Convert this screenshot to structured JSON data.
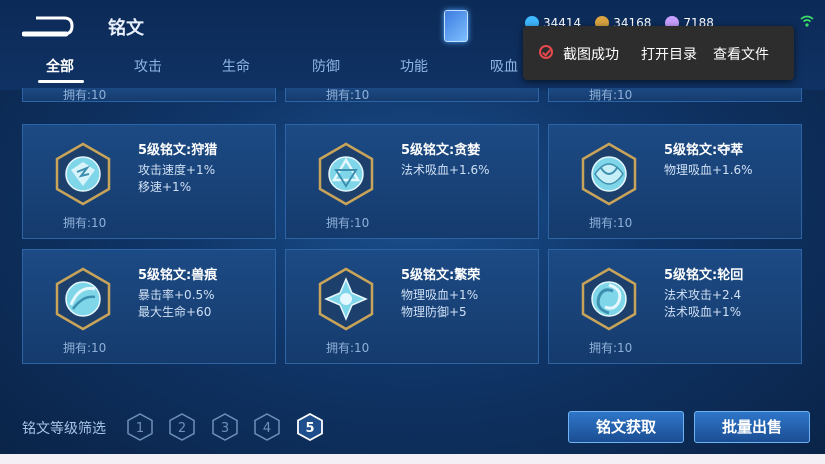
{
  "header": {
    "title": "铭文",
    "currencies": [
      {
        "icon": "diamond-icon",
        "value": "34414",
        "color": "#3fb8ff"
      },
      {
        "icon": "gold-coin-icon",
        "value": "34168",
        "color": "#d9a441"
      },
      {
        "icon": "gem-icon",
        "value": "7188",
        "color": "#c8a0ff"
      }
    ]
  },
  "tabs": [
    {
      "label": "全部",
      "active": true
    },
    {
      "label": "攻击",
      "active": false
    },
    {
      "label": "生命",
      "active": false
    },
    {
      "label": "防御",
      "active": false
    },
    {
      "label": "功能",
      "active": false
    },
    {
      "label": "吸血",
      "active": false
    }
  ],
  "toast": {
    "message": "截图成功",
    "open_dir": "打开目录",
    "view_file": "查看文件"
  },
  "top_row": [
    {
      "owned": "拥有:10"
    },
    {
      "owned": "拥有:10"
    },
    {
      "owned": "拥有:10"
    }
  ],
  "inscriptions": [
    {
      "name": "5级铭文:狩猎",
      "attrs": [
        "攻击速度+1%",
        "移速+1%"
      ],
      "owned": "拥有:10",
      "icon": "hunt-emblem-icon"
    },
    {
      "name": "5级铭文:贪婪",
      "attrs": [
        "法术吸血+1.6%"
      ],
      "owned": "拥有:10",
      "icon": "greed-emblem-icon"
    },
    {
      "name": "5级铭文:夺萃",
      "attrs": [
        "物理吸血+1.6%"
      ],
      "owned": "拥有:10",
      "icon": "plunder-emblem-icon"
    },
    {
      "name": "5级铭文:兽痕",
      "attrs": [
        "暴击率+0.5%",
        "最大生命+60"
      ],
      "owned": "拥有:10",
      "icon": "beast-mark-emblem-icon"
    },
    {
      "name": "5级铭文:繁荣",
      "attrs": [
        "物理吸血+1%",
        "物理防御+5"
      ],
      "owned": "拥有:10",
      "icon": "prosperity-emblem-icon"
    },
    {
      "name": "5级铭文:轮回",
      "attrs": [
        "法术攻击+2.4",
        "法术吸血+1%"
      ],
      "owned": "拥有:10",
      "icon": "cycle-emblem-icon"
    }
  ],
  "filter": {
    "label": "铭文等级筛选",
    "levels": [
      "1",
      "2",
      "3",
      "4",
      "5"
    ],
    "selected": "5"
  },
  "buttons": {
    "obtain": "铭文获取",
    "bulk_sell": "批量出售"
  }
}
